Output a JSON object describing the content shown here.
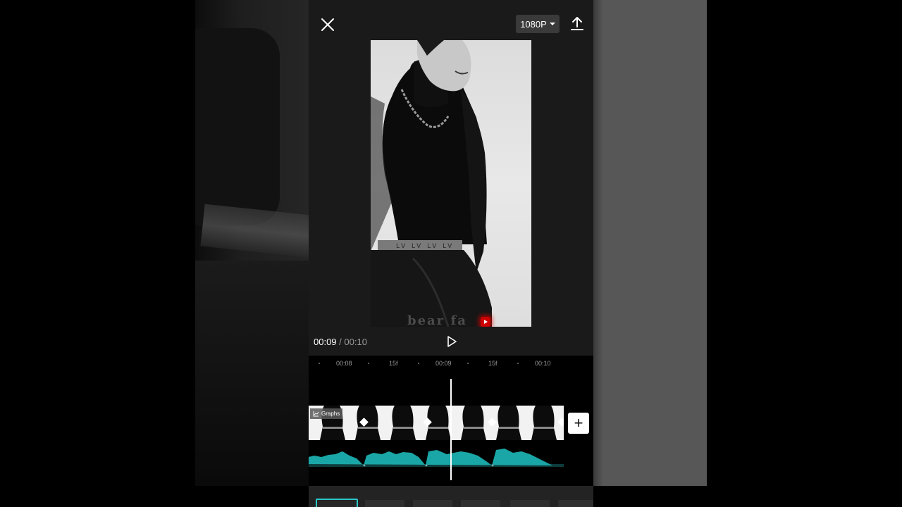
{
  "header": {
    "resolution_label": "1080P"
  },
  "player": {
    "current_time": "00:09",
    "separator": "/",
    "total_time": "00:10",
    "watermark_text": "bear fa"
  },
  "ruler": {
    "ticks": [
      "00:08",
      "15f",
      "00:09",
      "15f",
      "00:10"
    ]
  },
  "track": {
    "clip_label": "Graphs"
  },
  "colors": {
    "accent": "#2dc6c6",
    "waveform": "#1aa6a6",
    "panel": "#1a1a1a"
  },
  "icons": {
    "close": "close-icon",
    "export": "upload-icon",
    "play": "play-icon",
    "add": "plus-icon",
    "graph": "graph-icon"
  }
}
